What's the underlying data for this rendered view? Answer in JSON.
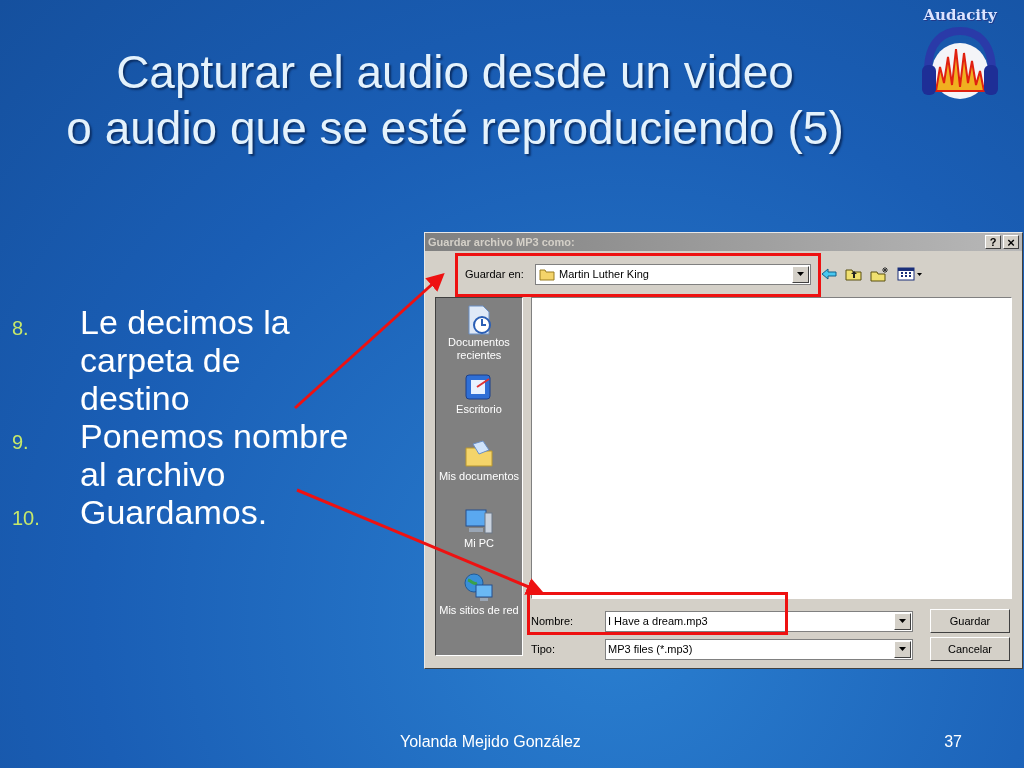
{
  "slide": {
    "title_lines": [
      "Capturar el audio desde un video",
      "o audio que se esté reproduciendo (5)"
    ],
    "logo": {
      "text": "Audacity"
    },
    "steps": [
      {
        "number": "8.",
        "text": "Le decimos la carpeta de destino"
      },
      {
        "number": "9.",
        "text": "Ponemos nombre al archivo"
      },
      {
        "number": "10.",
        "text": "Guardamos."
      }
    ],
    "footer": {
      "author": "Yolanda Mejido González",
      "page": "37"
    }
  },
  "dialog": {
    "title": "Guardar archivo MP3 como:",
    "help": "?",
    "close": "×",
    "location": {
      "label": "Guardar en:",
      "value": "Martin Luther King"
    },
    "places": [
      {
        "kind": "recent",
        "label": "Documentos recientes"
      },
      {
        "kind": "desktop",
        "label": "Escritorio"
      },
      {
        "kind": "documents",
        "label": "Mis documentos"
      },
      {
        "kind": "computer",
        "label": "Mi PC"
      },
      {
        "kind": "network",
        "label": "Mis sitios de red"
      }
    ],
    "filename": {
      "label": "Nombre:",
      "value": "I Have a dream.mp3"
    },
    "filetype": {
      "label": "Tipo:",
      "value": "MP3 files (*.mp3)"
    },
    "buttons": [
      "Guardar",
      "Cancelar"
    ]
  }
}
